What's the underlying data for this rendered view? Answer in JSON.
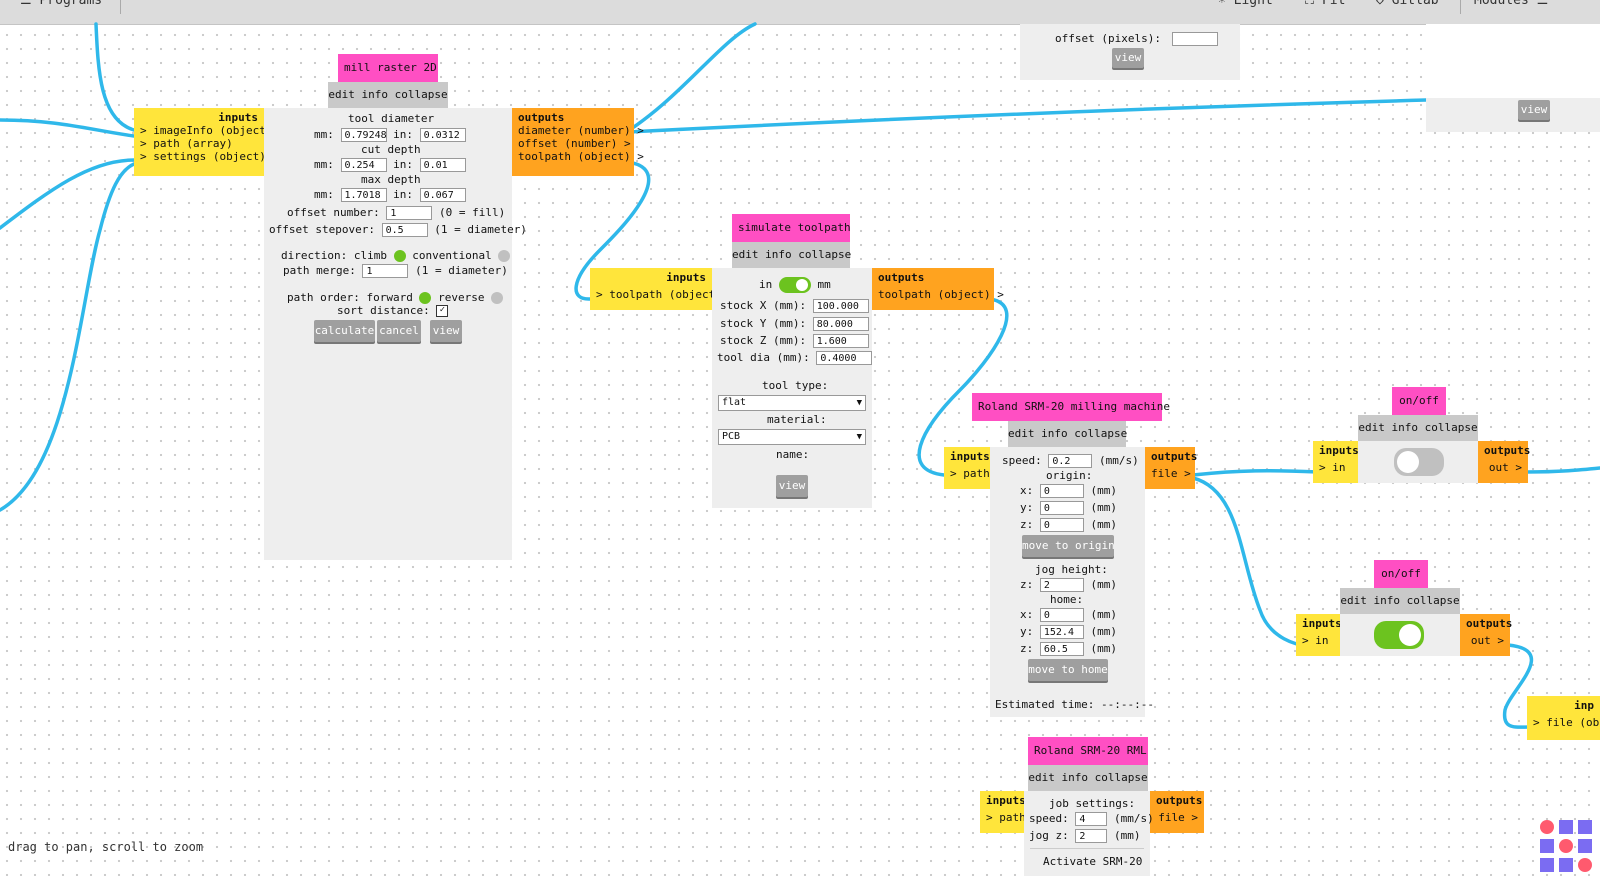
{
  "topbar": {
    "programs": "☰ Programs",
    "light": "☀ Light",
    "fit": "⛶ Fit",
    "gitlab": "◇ Gitlab",
    "modules": "Modules ☰"
  },
  "top_fragment": {
    "offset_label": "offset (pixels):",
    "offset_value": "",
    "view": "view"
  },
  "right_fragment": {
    "view": "view"
  },
  "mill": {
    "title": "mill raster 2D",
    "bar": "edit info collapse",
    "inputs_header": "inputs",
    "inputs": [
      "> imageInfo (object)",
      "> path (array)",
      "> settings (object)"
    ],
    "outputs_header": "outputs",
    "outputs": [
      "diameter (number) >",
      "offset (number) >",
      "toolpath (object) >"
    ],
    "tool_diameter": "tool diameter",
    "cut_depth": "cut depth",
    "max_depth": "max depth",
    "mm_label": "mm:",
    "in_label": "in:",
    "td_mm": "0.79248",
    "td_in": "0.0312",
    "cd_mm": "0.254",
    "cd_in": "0.01",
    "md_mm": "1.7018",
    "md_in": "0.067",
    "offset_number_label": "offset number:",
    "offset_number": "1",
    "offset_number_note": "(0 = fill)",
    "offset_stepover_label": "offset stepover:",
    "offset_stepover": "0.5",
    "offset_stepover_note": "(1 = diameter)",
    "direction_label": "direction: climb",
    "conventional": "conventional",
    "path_merge_label": "path merge:",
    "path_merge": "1",
    "path_merge_note": "(1 = diameter)",
    "path_order_label": "path order: forward",
    "reverse": "reverse",
    "sort_distance": "sort distance:",
    "calculate": "calculate",
    "cancel": "cancel",
    "view": "view"
  },
  "simulate": {
    "title": "simulate toolpath",
    "bar": "edit info collapse",
    "inputs_header": "inputs",
    "inputs": [
      "> toolpath (object)"
    ],
    "outputs_header": "outputs",
    "outputs": [
      "toolpath (object) >"
    ],
    "in": "in",
    "mm": "mm",
    "stock_x_label": "stock X (mm):",
    "stock_x": "100.000",
    "stock_y_label": "stock Y (mm):",
    "stock_y": "80.000",
    "stock_z_label": "stock Z (mm):",
    "stock_z": "1.600",
    "tool_dia_label": "tool dia (mm):",
    "tool_dia": "0.4000",
    "tool_type_label": "tool type:",
    "tool_type": "flat",
    "material_label": "material:",
    "material": "PCB",
    "name_label": "name:",
    "view": "view"
  },
  "roland": {
    "title": "Roland SRM-20 milling machine",
    "bar": "edit info collapse",
    "inputs_header": "inputs",
    "inputs": [
      "> path"
    ],
    "outputs_header": "outputs",
    "outputs": [
      "file >"
    ],
    "speed_label": "speed:",
    "speed": "0.2",
    "speed_unit": "(mm/s)",
    "origin_label": "origin:",
    "x_label": "x:",
    "y_label": "y:",
    "z_label": "z:",
    "mm_unit": "(mm)",
    "origin_x": "0",
    "origin_y": "0",
    "origin_z": "0",
    "move_to_origin": "move to origin",
    "jog_height_label": "jog height:",
    "jog_z": "2",
    "home_label": "home:",
    "home_x": "0",
    "home_y": "152.4",
    "home_z": "60.5",
    "move_to_home": "move to home",
    "estimated_time": "Estimated time: --:--:--"
  },
  "onoff1": {
    "title": "on/off",
    "bar": "edit info collapse",
    "inputs_header": "inputs",
    "inputs": [
      "> in"
    ],
    "outputs_header": "outputs",
    "outputs": [
      "out >"
    ],
    "state": "off"
  },
  "onoff2": {
    "title": "on/off",
    "bar": "edit info collapse",
    "inputs_header": "inputs",
    "inputs": [
      "> in"
    ],
    "outputs_header": "outputs",
    "outputs": [
      "out >"
    ],
    "state": "on"
  },
  "rml": {
    "title": "Roland SRM-20 RML",
    "bar": "edit info collapse",
    "inputs_header": "inputs",
    "inputs": [
      "> path"
    ],
    "outputs_header": "outputs",
    "outputs": [
      "file >"
    ],
    "job_settings": "job settings:",
    "speed_label": "speed:",
    "speed": "4",
    "speed_unit": "(mm/s)",
    "jog_label": "jog z:",
    "jog": "2",
    "jog_unit": "(mm)",
    "activate": "Activate SRM-20"
  },
  "edge_node": {
    "inputs_header": "inp",
    "inputs": [
      "> file (obje"
    ]
  },
  "hint": "drag to pan, scroll to zoom",
  "colors": {
    "wire": "#2fb8ea",
    "title": "#ff4fc3",
    "inputs": "#ffe53b",
    "outputs": "#ffa31f",
    "toggle_on": "#6cc31f"
  }
}
